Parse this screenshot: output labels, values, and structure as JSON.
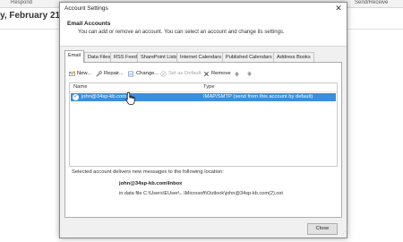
{
  "background": {
    "ribbon_labels": [
      "Respond",
      "Send/Receive"
    ],
    "date_heading": "y, February 21, 201"
  },
  "dialog": {
    "title": "Account Settings",
    "close_glyph": "✕",
    "header_title": "Email Accounts",
    "header_subtitle": "You can add or remove an account. You can select an account and change its settings.",
    "tabs": [
      {
        "label": "Email",
        "active": true
      },
      {
        "label": "Data Files"
      },
      {
        "label": "RSS Feeds"
      },
      {
        "label": "SharePoint Lists"
      },
      {
        "label": "Internet Calendars"
      },
      {
        "label": "Published Calendars"
      },
      {
        "label": "Address Books"
      }
    ],
    "toolbar": {
      "new": "New...",
      "repair": "Repair...",
      "change": "Change...",
      "set_default": "Set as Default",
      "remove": "Remove"
    },
    "list": {
      "col_name": "Name",
      "col_type": "Type",
      "rows": [
        {
          "name": "john@34sp-kb.com",
          "type": "IMAP/SMTP (send from this account by default)",
          "selected": true
        }
      ]
    },
    "delivery_info": "Selected account delivers new messages to the following location:",
    "inbox_location": "john@34sp-kb.com\\Inbox",
    "data_file": "in data file C:\\Users\\EUser\\...\\Microsoft\\Outlook\\john@34sp-kb.com(2).ost",
    "close_button": "Close",
    "colors": {
      "selection": "#3a8fdd",
      "dialog_bg": "#f0f0f0"
    }
  }
}
